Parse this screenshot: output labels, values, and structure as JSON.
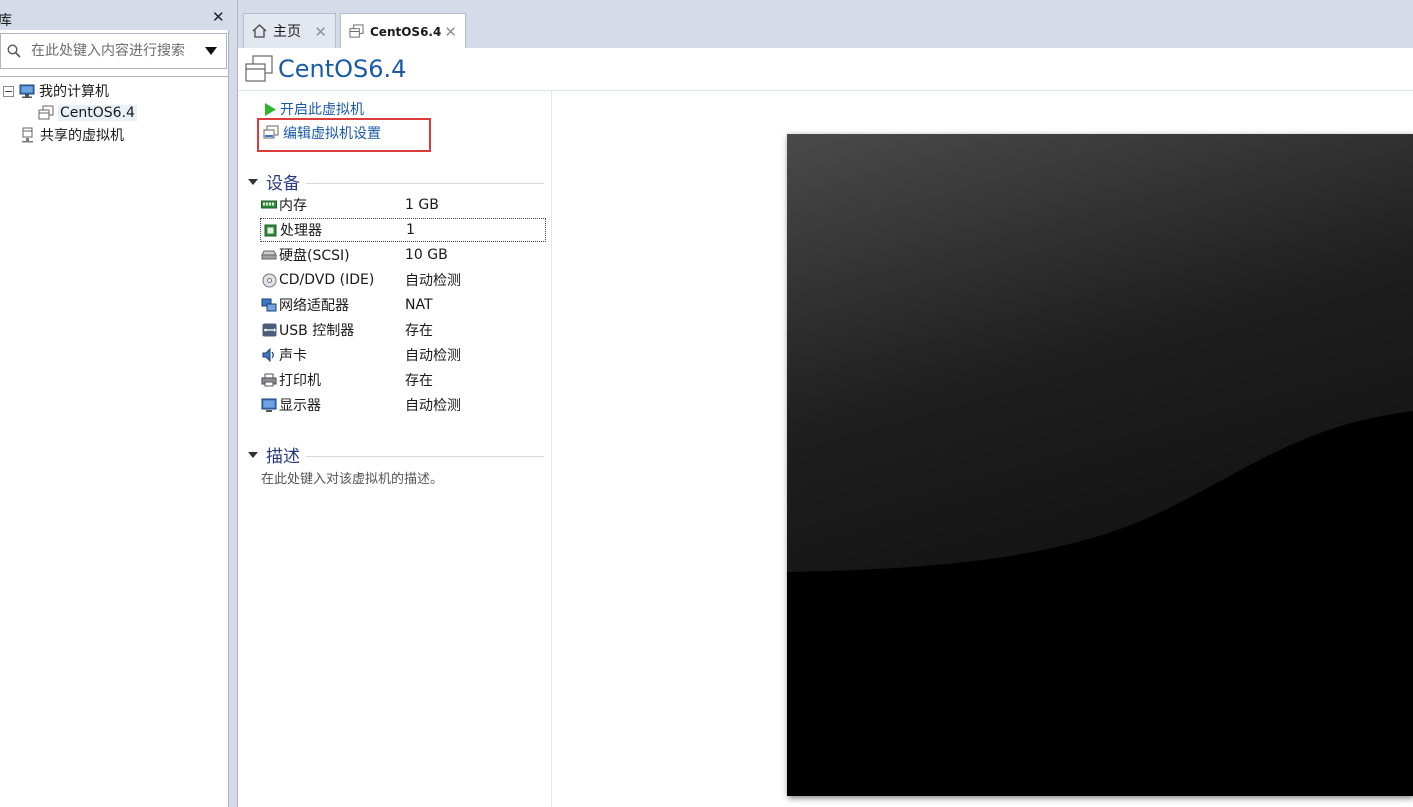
{
  "library": {
    "title": "库",
    "close_glyph": "✕",
    "search_placeholder": "在此处键入内容进行搜索",
    "tree": {
      "my_computer": {
        "label": "我的计算机",
        "expander": "−"
      },
      "vm": {
        "label": "CentOS6.4"
      },
      "shared": {
        "label": "共享的虚拟机"
      }
    }
  },
  "tabs": [
    {
      "label": "主页",
      "icon": "home-icon",
      "active": false
    },
    {
      "label": "CentOS6.4",
      "icon": "vm-icon",
      "active": true
    }
  ],
  "tab_close_glyph": "✕",
  "vm": {
    "title": "CentOS6.4",
    "actions": {
      "power_on": "开启此虚拟机",
      "edit_settings": "编辑虚拟机设置"
    },
    "devices_section": "设备",
    "devices": [
      {
        "name": "内存",
        "value": "1 GB",
        "icon": "memory-icon"
      },
      {
        "name": "处理器",
        "value": "1",
        "icon": "processor-icon"
      },
      {
        "name": "硬盘(SCSI)",
        "value": "10 GB",
        "icon": "harddisk-icon"
      },
      {
        "name": "CD/DVD (IDE)",
        "value": "自动检测",
        "icon": "cdrom-icon"
      },
      {
        "name": "网络适配器",
        "value": "NAT",
        "icon": "network-icon"
      },
      {
        "name": "USB 控制器",
        "value": "存在",
        "icon": "usb-icon"
      },
      {
        "name": "声卡",
        "value": "自动检测",
        "icon": "sound-icon"
      },
      {
        "name": "打印机",
        "value": "存在",
        "icon": "printer-icon"
      },
      {
        "name": "显示器",
        "value": "自动检测",
        "icon": "display-icon"
      }
    ],
    "description_section": "描述",
    "description_placeholder": "在此处键入对该虚拟机的描述。"
  },
  "colors": {
    "accent": "#1a5aa8",
    "section": "#2a3b80",
    "highlight": "#e03b3b",
    "chrome": "#d6dbe9"
  }
}
